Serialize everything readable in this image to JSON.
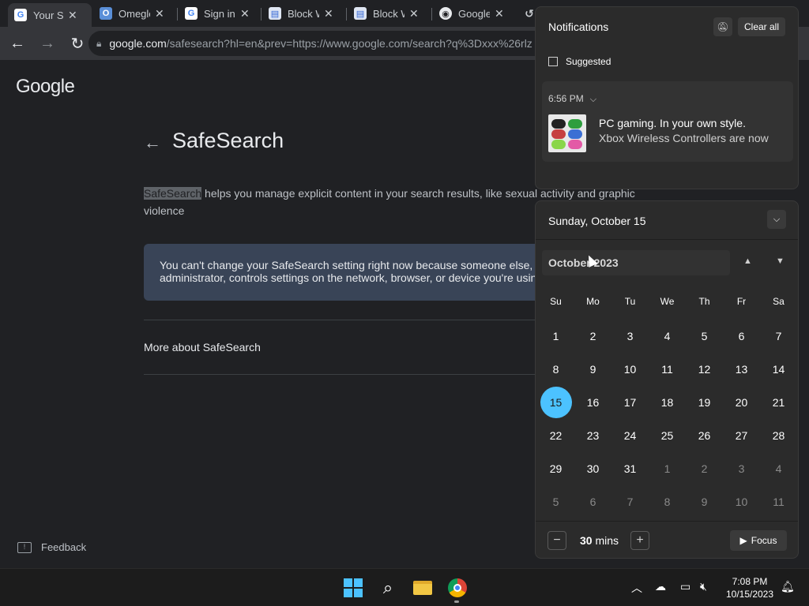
{
  "browser": {
    "tabs": [
      {
        "label": "Your SafeSearch",
        "icon": "google-g-icon"
      },
      {
        "label": "Omegle",
        "icon": "omegle-icon"
      },
      {
        "label": "Sign in",
        "icon": "google-g-icon"
      },
      {
        "label": "Block Websites",
        "icon": "doc-icon"
      },
      {
        "label": "Block Websites",
        "icon": "doc-icon"
      },
      {
        "label": "Google",
        "icon": "google-chrome-icon"
      }
    ],
    "url_host": "google.com",
    "url_path": "/safesearch?hl=en&prev=https://www.google.com/search?q%3Dxxx%26rlz"
  },
  "page": {
    "logo": "Google",
    "title": "SafeSearch",
    "desc_highlight": "SafeSearch",
    "desc_rest": " helps you manage explicit content in your search results, like sexual activity and graphic violence",
    "notice_line1": "You can't change your SafeSearch setting right now because someone else,",
    "notice_line2": "administrator, controls settings on the network, browser, or device you're usin",
    "more_link": "More about SafeSearch",
    "feedback": "Feedback"
  },
  "notifications": {
    "header": "Notifications",
    "clear_all": "Clear all",
    "section": "Suggested",
    "time": "6:56 PM",
    "title": "PC gaming. In your own style.",
    "body": "Xbox Wireless Controllers are now"
  },
  "calendar": {
    "date_header": "Sunday, October 15",
    "month": "October 2023",
    "weekdays": [
      "Su",
      "Mo",
      "Tu",
      "We",
      "Th",
      "Fr",
      "Sa"
    ],
    "weeks": [
      [
        "1",
        "2",
        "3",
        "4",
        "5",
        "6",
        "7"
      ],
      [
        "8",
        "9",
        "10",
        "11",
        "12",
        "13",
        "14"
      ],
      [
        "15",
        "16",
        "17",
        "18",
        "19",
        "20",
        "21"
      ],
      [
        "22",
        "23",
        "24",
        "25",
        "26",
        "27",
        "28"
      ],
      [
        "29",
        "30",
        "31",
        "1",
        "2",
        "3",
        "4"
      ],
      [
        "5",
        "6",
        "7",
        "8",
        "9",
        "10",
        "11"
      ]
    ],
    "today": "15",
    "focus_minutes": "30",
    "focus_unit": "mins",
    "focus_label": "Focus",
    "accent": "#4cc2ff"
  },
  "taskbar": {
    "time": "7:08 PM",
    "date": "10/15/2023"
  }
}
